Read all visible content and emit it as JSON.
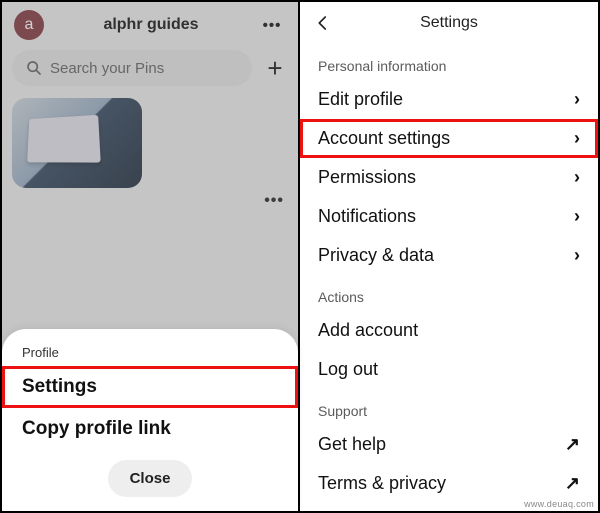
{
  "left": {
    "avatar_initial": "a",
    "title": "alphr guides",
    "search_placeholder": "Search your Pins",
    "sheet": {
      "section": "Profile",
      "settings": "Settings",
      "copy_link": "Copy profile link",
      "close": "Close"
    }
  },
  "right": {
    "title": "Settings",
    "sections": {
      "personal": "Personal information",
      "actions": "Actions",
      "support": "Support"
    },
    "items": {
      "edit_profile": "Edit profile",
      "account_settings": "Account settings",
      "permissions": "Permissions",
      "notifications": "Notifications",
      "privacy_data": "Privacy & data",
      "add_account": "Add account",
      "log_out": "Log out",
      "get_help": "Get help",
      "terms_privacy": "Terms & privacy"
    }
  },
  "watermark": "www.deuaq.com"
}
